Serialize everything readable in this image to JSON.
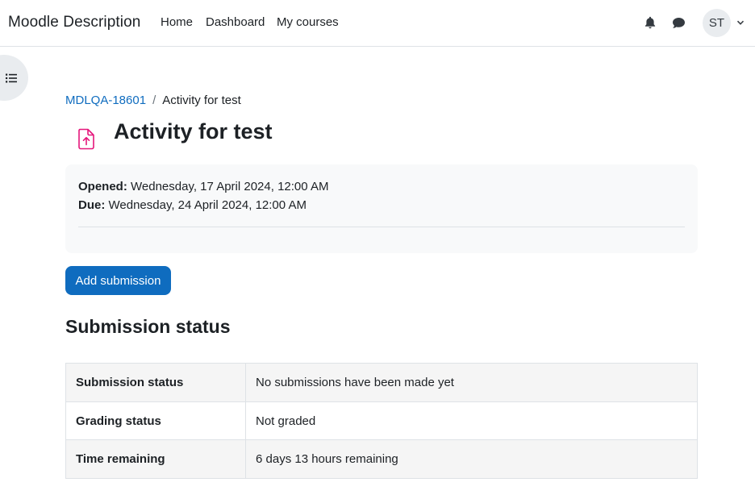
{
  "navbar": {
    "brand": "Moodle Description",
    "links": [
      "Home",
      "Dashboard",
      "My courses"
    ],
    "avatar_initials": "ST"
  },
  "breadcrumb": {
    "course": "MDLQA-18601",
    "separator": "/",
    "current": "Activity for test"
  },
  "activity": {
    "title": "Activity for test",
    "icon_color": "#e5177b",
    "opened_label": "Opened:",
    "opened_value": " Wednesday, 17 April 2024, 12:00 AM",
    "due_label": "Due:",
    "due_value": " Wednesday, 24 April 2024, 12:00 AM"
  },
  "actions": {
    "add_submission": "Add submission"
  },
  "submission_status": {
    "heading": "Submission status",
    "rows": [
      {
        "label": "Submission status",
        "value": "No submissions have been made yet"
      },
      {
        "label": "Grading status",
        "value": "Not graded"
      },
      {
        "label": "Time remaining",
        "value": "6 days 13 hours remaining"
      }
    ]
  },
  "colors": {
    "primary": "#0f6cbf",
    "assignment_icon": "#e5177b"
  }
}
